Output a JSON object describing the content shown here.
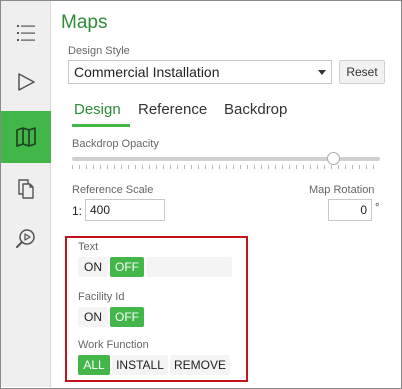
{
  "nav": {
    "items": [
      {
        "icon": "list-icon",
        "name": "layers"
      },
      {
        "icon": "play-triangle-icon",
        "name": "run"
      },
      {
        "icon": "map-icon",
        "name": "maps",
        "active": true
      },
      {
        "icon": "documents-icon",
        "name": "documents"
      },
      {
        "icon": "search-play-icon",
        "name": "inspect"
      }
    ]
  },
  "header": {
    "title": "Maps"
  },
  "design_style": {
    "label": "Design Style",
    "value": "Commercial Installation",
    "reset_label": "Reset"
  },
  "tabs": [
    {
      "label": "Design",
      "active": true
    },
    {
      "label": "Reference",
      "active": false
    },
    {
      "label": "Backdrop",
      "active": false
    }
  ],
  "backdrop_opacity": {
    "label": "Backdrop Opacity",
    "value": 0.85
  },
  "reference_scale": {
    "label": "Reference Scale",
    "prefix": "1:",
    "value": "400"
  },
  "map_rotation": {
    "label": "Map Rotation",
    "value": "0",
    "unit": "°"
  },
  "toggles": {
    "text": {
      "label": "Text",
      "options": [
        "ON",
        "OFF"
      ],
      "selected": "OFF"
    },
    "facility_id": {
      "label": "Facility Id",
      "options": [
        "ON",
        "OFF"
      ],
      "selected": "OFF"
    },
    "work_function": {
      "label": "Work Function",
      "options": [
        "ALL",
        "INSTALL",
        "REMOVE"
      ],
      "selected": "ALL"
    }
  },
  "colors": {
    "accent": "#43b649",
    "title": "#2f8a3a",
    "highlight": "#c0141f"
  }
}
